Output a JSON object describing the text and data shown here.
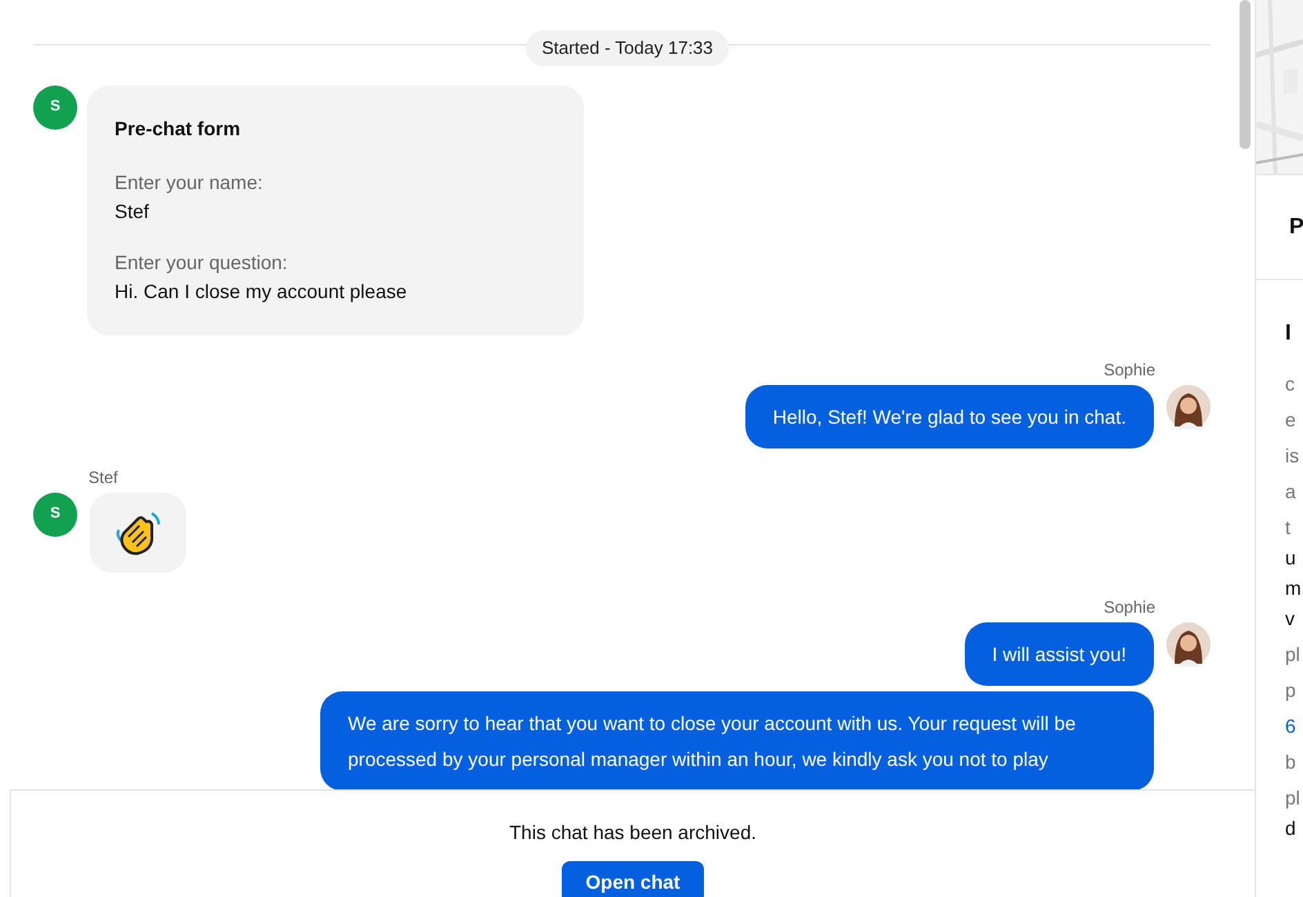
{
  "chat": {
    "started": "Started - Today 17:33",
    "messages": [
      {
        "kind": "form",
        "avatar": "S",
        "title": "Pre-chat form",
        "fields": [
          {
            "label": "Enter your name:",
            "value": "Stef"
          },
          {
            "label": "Enter your question:",
            "value": "Hi. Can I close my account please"
          }
        ]
      },
      {
        "kind": "agent",
        "author": "Sophie",
        "bubbles": [
          "Hello, Stef! We're glad to see you in chat."
        ]
      },
      {
        "kind": "emoji",
        "author": "Stef",
        "avatar": "S"
      },
      {
        "kind": "agent",
        "author": "Sophie",
        "bubbles": [
          "I will assist you!",
          "We are sorry to hear that you want to close your account with us. Your request will be processed by your personal manager within an hour, we kindly ask you not to play"
        ]
      }
    ],
    "archived": {
      "text": "This chat has been archived.",
      "button": "Open chat"
    }
  },
  "side": {
    "heading_1": "P",
    "heading_2": "I",
    "lines": [
      {
        "kind": "muted",
        "text": "c"
      },
      {
        "kind": "muted",
        "text": "e"
      },
      {
        "kind": "muted",
        "text": "is"
      },
      {
        "kind": "muted",
        "text": "a"
      },
      {
        "kind": "muted",
        "text": "t"
      },
      {
        "kind": "dark",
        "text": "u"
      },
      {
        "kind": "dark",
        "text": "m"
      },
      {
        "kind": "dark",
        "text": "v"
      },
      {
        "kind": "muted",
        "text": "pl"
      },
      {
        "kind": "muted",
        "text": "p"
      },
      {
        "kind": "link",
        "text": "6"
      },
      {
        "kind": "muted",
        "text": "b"
      },
      {
        "kind": "muted",
        "text": "pl"
      },
      {
        "kind": "dark",
        "text": "d"
      }
    ]
  }
}
